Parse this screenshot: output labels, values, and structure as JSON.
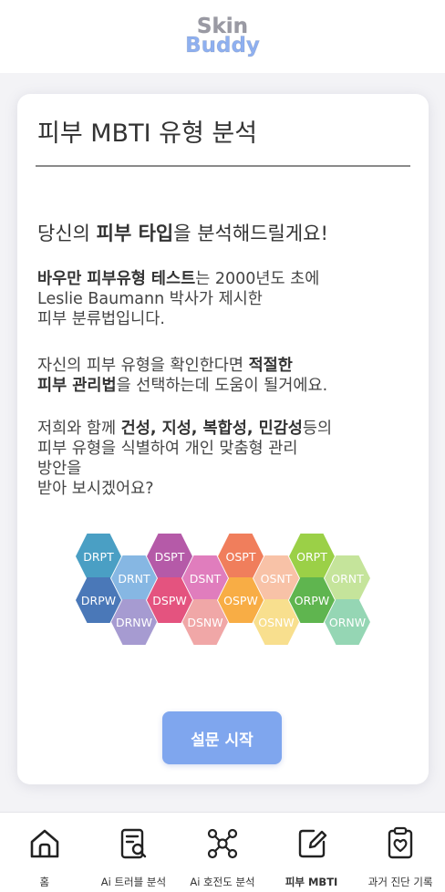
{
  "header": {
    "logo_line1": "Skin",
    "logo_line2": "Buddy"
  },
  "card": {
    "title": "피부 MBTI 유형 분석",
    "intro": {
      "pre": "당신의 ",
      "bold": "피부 타입",
      "post": "을 분석해드릴게요!"
    },
    "para1": {
      "bold": "바우만 피부유형 테스트",
      "post": "는 2000년도 초에",
      "line2": "Leslie Baumann 박사가 제시한",
      "line3": "피부 분류법입니다."
    },
    "para2": {
      "pre": "자신의 피부 유형을 확인한다면 ",
      "bold1": "적절한",
      "bold2": "피부 관리법",
      "post": "을 선택하는데 도움이 될거에요."
    },
    "para3": {
      "pre": "저희와 함께  ",
      "b1": "건성",
      "sep1": ", ",
      "b2": "지성",
      "sep2": ", ",
      "b3": "복합성",
      "sep3": ", ",
      "b4": "민감성",
      "post": "등의",
      "line2": "피부 유형을 식별하여 개인 맞춤형 관리",
      "line3": "방안을",
      "line4": "받아 보시겠어요?"
    },
    "hexagons": [
      {
        "label": "DRPT",
        "color": "#4a9fc4"
      },
      {
        "label": "DRNT",
        "color": "#86b7e3"
      },
      {
        "label": "DRPW",
        "color": "#4a78b8"
      },
      {
        "label": "DRNW",
        "color": "#a69bd1"
      },
      {
        "label": "DSPT",
        "color": "#b55aa8"
      },
      {
        "label": "DSNT",
        "color": "#e07dbd"
      },
      {
        "label": "DSPW",
        "color": "#e4537f"
      },
      {
        "label": "DSNW",
        "color": "#f0a7a7"
      },
      {
        "label": "OSPT",
        "color": "#f07e5c"
      },
      {
        "label": "OSNT",
        "color": "#f8c2a7"
      },
      {
        "label": "OSPW",
        "color": "#f8ad45"
      },
      {
        "label": "OSNW",
        "color": "#f8df8e"
      },
      {
        "label": "ORPT",
        "color": "#9bd047"
      },
      {
        "label": "ORNT",
        "color": "#c5e49b"
      },
      {
        "label": "ORPW",
        "color": "#5fb54f"
      },
      {
        "label": "ORNW",
        "color": "#95d6b4"
      }
    ],
    "start_button": "설문 시작"
  },
  "nav": {
    "items": [
      {
        "label": "홈",
        "icon": "home-icon"
      },
      {
        "label": "Ai 트러블 분석",
        "icon": "document-search-icon"
      },
      {
        "label": "Ai 호전도 분석",
        "icon": "molecule-icon"
      },
      {
        "label": "피부 MBTI",
        "icon": "edit-document-icon"
      },
      {
        "label": "과거 진단 기록",
        "icon": "medical-clipboard-icon"
      }
    ],
    "active_index": 3
  }
}
